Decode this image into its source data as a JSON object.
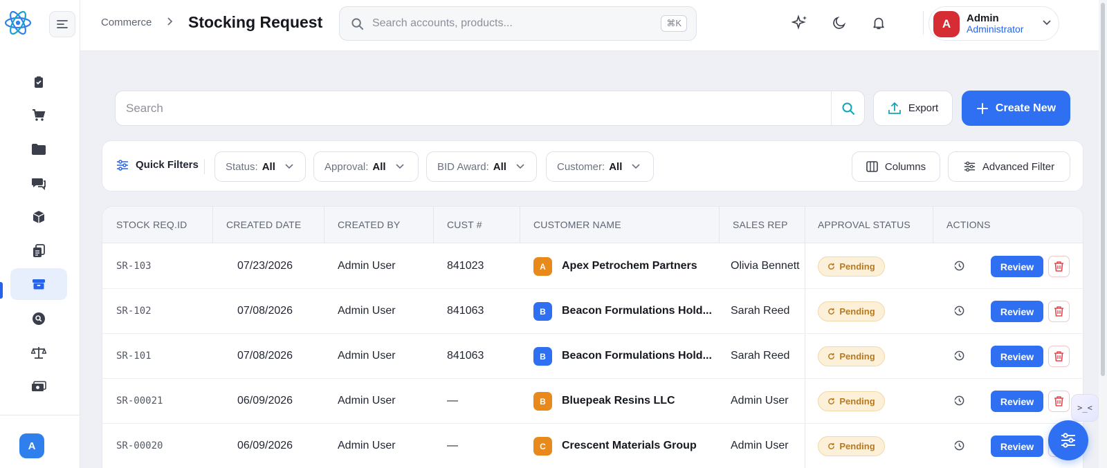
{
  "header": {
    "breadcrumb": "Commerce",
    "breadcrumb_sep": ">",
    "title": "Stocking Request",
    "search_placeholder": "Search accounts, products...",
    "search_shortcut": "⌘K",
    "user": {
      "initial": "A",
      "name": "Admin",
      "role": "Administrator"
    }
  },
  "sidebar": {
    "items": [
      {
        "icon": "clipboard-check-icon"
      },
      {
        "icon": "cart-icon"
      },
      {
        "icon": "folder-icon"
      },
      {
        "icon": "chat-icon"
      },
      {
        "icon": "box-icon"
      },
      {
        "icon": "documents-icon"
      },
      {
        "icon": "archive-icon",
        "active": true
      },
      {
        "icon": "search-circle-icon"
      },
      {
        "icon": "scale-icon"
      },
      {
        "icon": "money-icon"
      }
    ],
    "avatar_initial": "A"
  },
  "toolbar": {
    "search_placeholder": "Search",
    "export_label": "Export",
    "create_label": "Create New"
  },
  "filters": {
    "quick_filters_label": "Quick Filters",
    "pills": [
      {
        "label": "Status:",
        "value": "All"
      },
      {
        "label": "Approval:",
        "value": "All"
      },
      {
        "label": "BID Award:",
        "value": "All"
      },
      {
        "label": "Customer:",
        "value": "All"
      }
    ],
    "columns_label": "Columns",
    "advanced_label": "Advanced Filter"
  },
  "table": {
    "columns": [
      "STOCK REQ.ID",
      "CREATED DATE",
      "CREATED BY",
      "CUST #",
      "CUSTOMER NAME",
      "SALES REP",
      "APPROVAL STATUS",
      "ACTIONS"
    ],
    "rows": [
      {
        "id": "SR-103",
        "date": "07/23/2026",
        "by": "Admin User",
        "cust": "841023",
        "badge": "A",
        "badge_color": "#e8891c",
        "name": "Apex Petrochem Partners",
        "rep": "Olivia Bennett",
        "status": "Pending",
        "action": "Review"
      },
      {
        "id": "SR-102",
        "date": "07/08/2026",
        "by": "Admin User",
        "cust": "841063",
        "badge": "B",
        "badge_color": "#2f6ff2",
        "name": "Beacon Formulations Hold...",
        "rep": "Sarah Reed",
        "status": "Pending",
        "action": "Review"
      },
      {
        "id": "SR-101",
        "date": "07/08/2026",
        "by": "Admin User",
        "cust": "841063",
        "badge": "B",
        "badge_color": "#2f6ff2",
        "name": "Beacon Formulations Hold...",
        "rep": "Sarah Reed",
        "status": "Pending",
        "action": "Review"
      },
      {
        "id": "SR-00021",
        "date": "06/09/2026",
        "by": "Admin User",
        "cust": "—",
        "badge": "B",
        "badge_color": "#e8891c",
        "name": "Bluepeak Resins LLC",
        "rep": "Admin User",
        "status": "Pending",
        "action": "Review"
      },
      {
        "id": "SR-00020",
        "date": "06/09/2026",
        "by": "Admin User",
        "cust": "—",
        "badge": "C",
        "badge_color": "#e8891c",
        "name": "Crescent Materials Group",
        "rep": "Admin User",
        "status": "Pending",
        "action": "Review"
      }
    ]
  },
  "floating": {
    "code_label": ">_<"
  },
  "colors": {
    "accent": "#2f6ff2",
    "pending_bg": "#fdf0d8",
    "pending_text": "#b7791f",
    "delete": "#e0484f"
  }
}
